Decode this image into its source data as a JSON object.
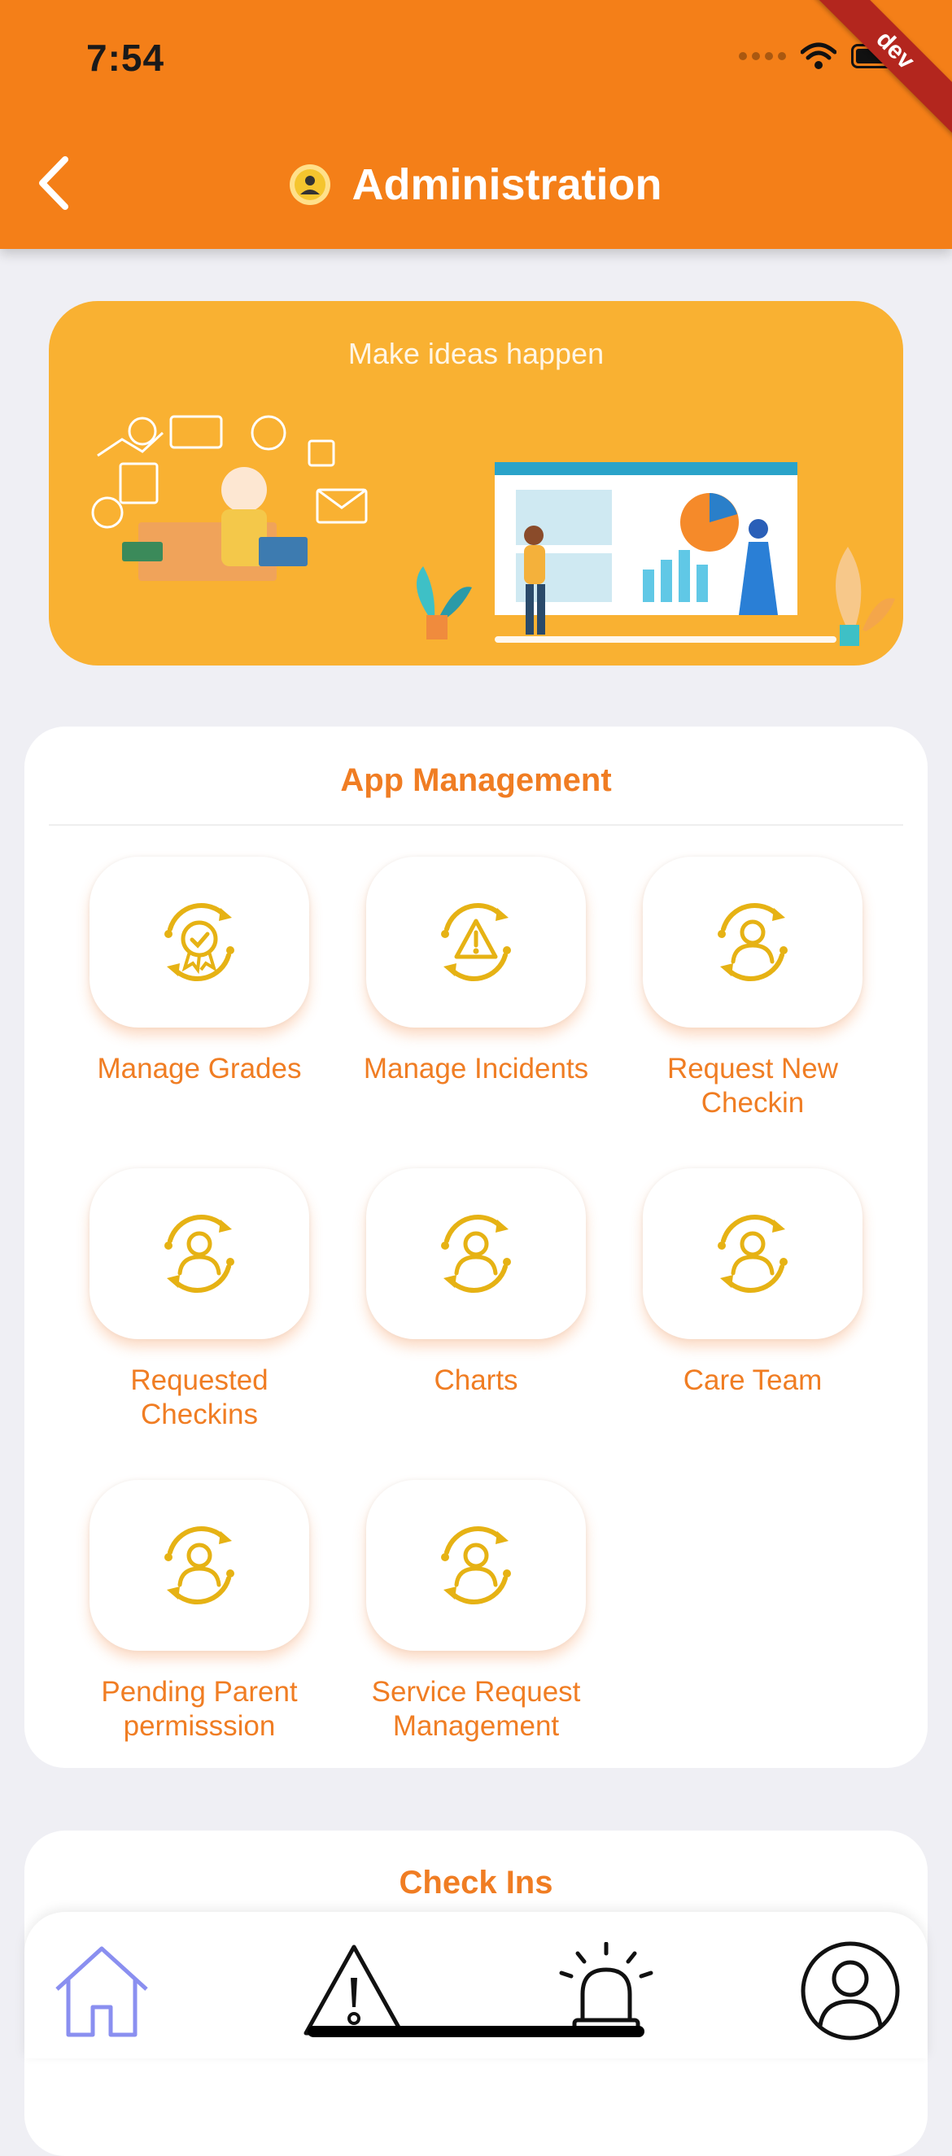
{
  "status_bar": {
    "time": "7:54",
    "ribbon": "dev"
  },
  "header": {
    "title": "Administration",
    "back_icon": "chevron-left-icon"
  },
  "banner": {
    "title": "Make ideas happen"
  },
  "app_management": {
    "title": "App Management",
    "tiles": [
      {
        "label": "Manage Grades",
        "icon": "award-badge-icon"
      },
      {
        "label": "Manage Incidents",
        "icon": "warning-triangle-icon"
      },
      {
        "label": "Request New Checkin",
        "icon": "user-cycle-icon"
      },
      {
        "label": "Requested Checkins",
        "icon": "user-cycle-icon"
      },
      {
        "label": "Charts",
        "icon": "user-cycle-icon"
      },
      {
        "label": "Care Team",
        "icon": "user-cycle-icon"
      },
      {
        "label": "Pending Parent permisssion",
        "icon": "user-cycle-icon"
      },
      {
        "label": "Service Request Management",
        "icon": "user-cycle-icon"
      }
    ]
  },
  "check_ins": {
    "title": "Check Ins"
  },
  "bottom_nav": {
    "items": [
      {
        "name": "home",
        "icon": "home-icon",
        "active": true
      },
      {
        "name": "incidents",
        "icon": "warning-icon",
        "active": false
      },
      {
        "name": "alerts",
        "icon": "siren-icon",
        "active": false
      },
      {
        "name": "profile",
        "icon": "profile-icon",
        "active": false
      }
    ]
  },
  "colors": {
    "primary": "#f47f18",
    "accent_text": "#f07d23",
    "icon_gold": "#e6b214",
    "banner": "#f9b132",
    "active_nav": "#8a8ff0"
  }
}
